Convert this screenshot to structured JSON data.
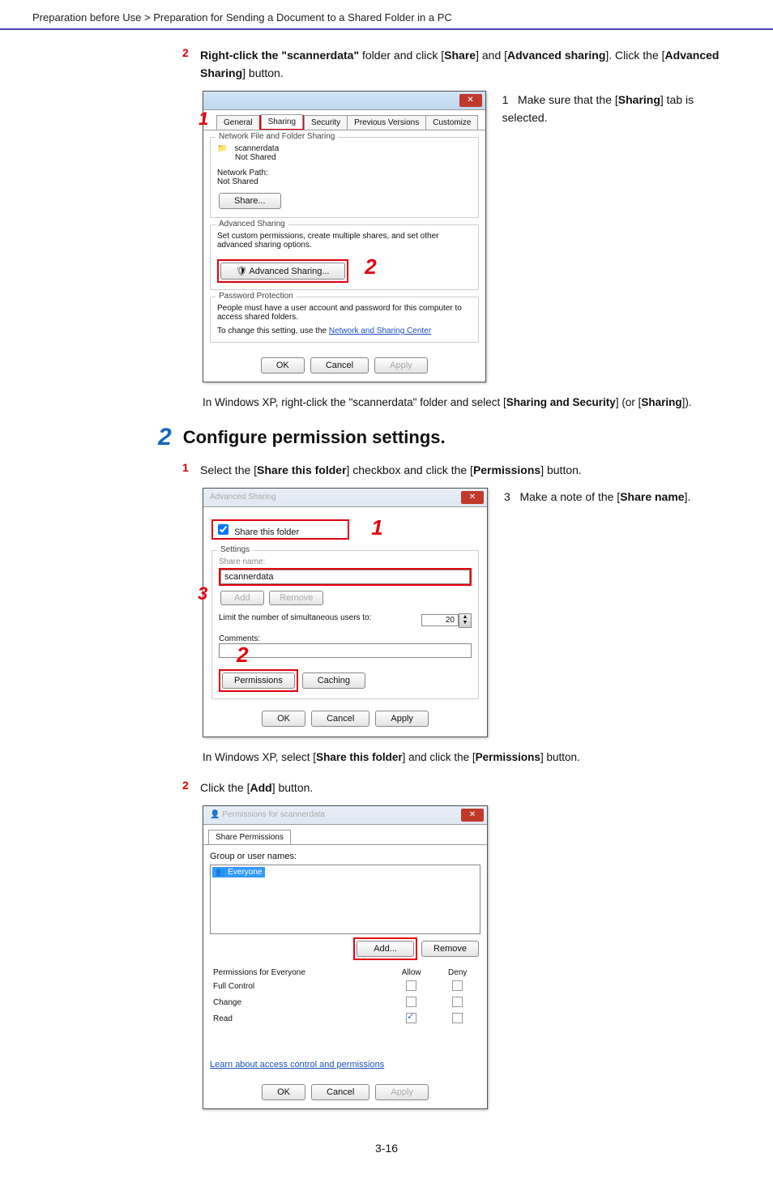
{
  "breadcrumb": "Preparation before Use > Preparation for Sending a Document to a Shared Folder in a PC",
  "substep1": {
    "num": "2",
    "text_pre": "Right-click the \"scannerdata\" ",
    "text_b1": "Right-click the \"scannerdata\"",
    "full": "Right-click the \"scannerdata\" folder and click [Share] and [Advanced sharing]. Click the [Advanced Sharing] button."
  },
  "note_right1": "1   Make sure that the [Sharing] tab is selected.",
  "dialog1": {
    "tabs": [
      "General",
      "Sharing",
      "Security",
      "Previous Versions",
      "Customize"
    ],
    "g1_title": "Network File and Folder Sharing",
    "g1_name": "scannerdata",
    "g1_status": "Not Shared",
    "g1_path_lbl": "Network Path:",
    "g1_path": "Not Shared",
    "g1_btn": "Share...",
    "g2_title": "Advanced Sharing",
    "g2_desc": "Set custom permissions, create multiple shares, and set other advanced sharing options.",
    "g2_btn": "Advanced Sharing...",
    "g3_title": "Password Protection",
    "g3_l1": "People must have a user account and password for this computer to access shared folders.",
    "g3_l2": "To change this setting, use the Network and Sharing Center",
    "ok": "OK",
    "cancel": "Cancel",
    "apply": "Apply"
  },
  "after1": "In Windows XP, right-click the \"scannerdata\" folder and select [Sharing and Security] (or [Sharing]).",
  "bigstep": {
    "num": "2",
    "title": "Configure permission settings."
  },
  "substep2": {
    "num": "1",
    "text": "Select the [Share this folder] checkbox and click the [Permissions] button."
  },
  "note_right2": "3   Make a note of the [Share name].",
  "dialog2": {
    "chk": "Share this folder",
    "settings": "Settings",
    "shname_lbl": "Share name:",
    "shname_val": "scannerdata",
    "add": "Add",
    "remove": "Remove",
    "limit": "Limit the number of simultaneous users to:",
    "limit_val": "20",
    "comments": "Comments:",
    "perm": "Permissions",
    "cache": "Caching",
    "ok": "OK",
    "cancel": "Cancel",
    "apply": "Apply"
  },
  "after2": "In Windows XP, select [Share this folder] and click the [Permissions] button.",
  "substep3": {
    "num": "2",
    "text": "Click the [Add] button."
  },
  "dialog3": {
    "tab": "Share Permissions",
    "grp": "Group or user names:",
    "everyone": "Everyone",
    "add": "Add...",
    "remove": "Remove",
    "pfor": "Permissions for Everyone",
    "allow": "Allow",
    "deny": "Deny",
    "r1": "Full Control",
    "r2": "Change",
    "r3": "Read",
    "link": "Learn about access control and permissions",
    "ok": "OK",
    "cancel": "Cancel",
    "apply": "Apply"
  },
  "pagenum": "3-16"
}
